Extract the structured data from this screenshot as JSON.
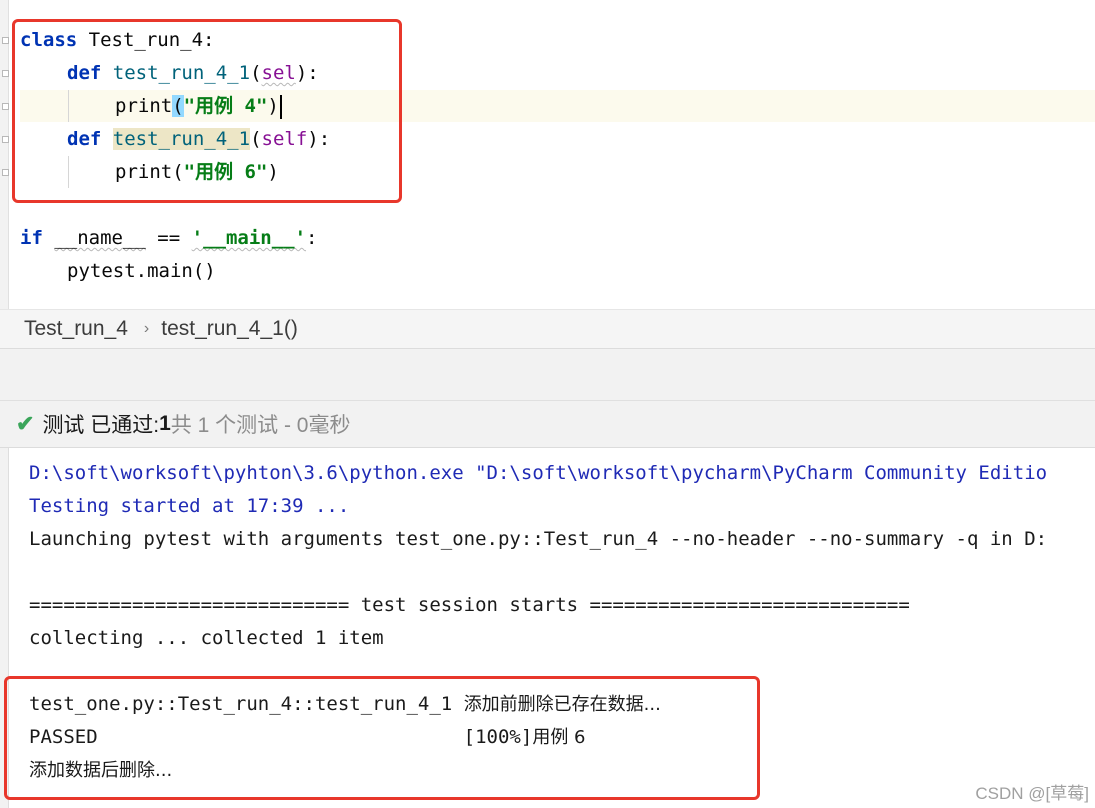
{
  "editor": {
    "class_kw": "class",
    "class_name": " Test_run_4:",
    "def_kw": "def",
    "method1_name": "test_run_4_1",
    "paren_open": "(",
    "param1": "sel",
    "paren_close_colon": "):",
    "print_fn": "print",
    "print1_arg": "\"用例 4\"",
    "close_paren": ")",
    "method2_name": "test_run_4_1",
    "param2": "self",
    "print2_arg": "\"用例 6\"",
    "if_kw": "if",
    "name_var": "__name__",
    "eq_op": " == ",
    "main_str": "'__main__'",
    "colon": ":",
    "main_call": "pytest.main()"
  },
  "breadcrumb": {
    "class_item": "Test_run_4",
    "separator": "›",
    "method_item": "test_run_4_1()"
  },
  "status": {
    "check_icon": "✔",
    "passed_label": "测试 已通过: ",
    "passed_count": "1",
    "total_text": "共 1 个测试 - 0毫秒"
  },
  "console": {
    "line1": "D:\\soft\\worksoft\\pyhton\\3.6\\python.exe \"D:\\soft\\worksoft\\pycharm\\PyCharm Community Editio",
    "line2": "Testing started at 17:39 ...",
    "line3": "Launching pytest with arguments test_one.py::Test_run_4 --no-header --no-summary -q in D:",
    "line4": "============================ test session starts ============================",
    "line5": "collecting ... collected 1 item",
    "line6_code": "test_one.py::Test_run_4::test_run_4_1 ",
    "line6_cn": "添加前删除已存在数据...",
    "line7_code": "PASSED                                [100%]",
    "line7_cn": "用例 6",
    "line8_cn": "添加数据后删除..."
  },
  "watermark": "CSDN @[草莓]",
  "colors": {
    "keyword": "#0033b3",
    "string": "#067d17",
    "param": "#871094",
    "console_blue": "#1f2ab5",
    "highlight_box": "#e8372b",
    "pass_green": "#3aa55a"
  }
}
